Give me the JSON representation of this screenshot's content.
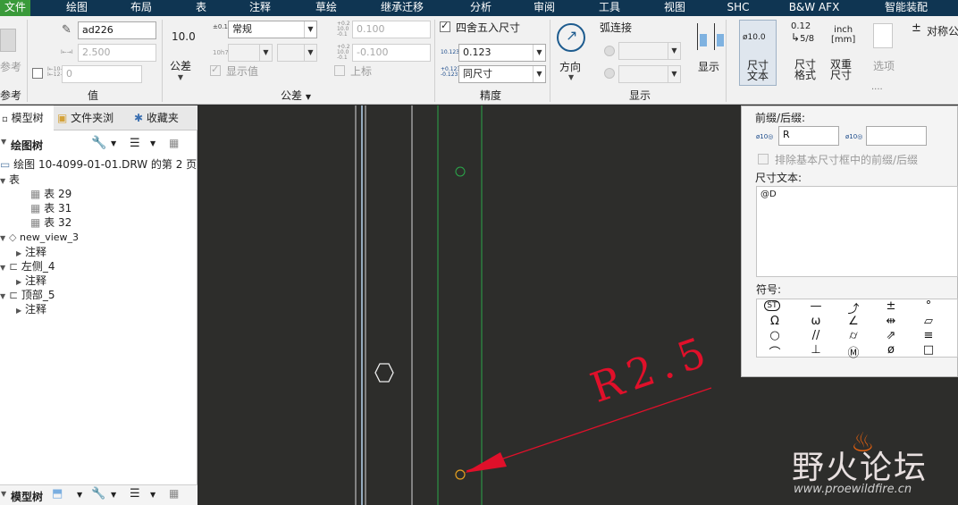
{
  "menubar": {
    "items": [
      "文件",
      "绘图",
      "布局",
      "表",
      "注释",
      "草绘",
      "继承迁移",
      "分析",
      "审阅",
      "工具",
      "视图",
      "SHC",
      "B&W AFX",
      "智能装配"
    ],
    "active": "文件"
  },
  "ribbon": {
    "ref_group": {
      "label": "参考",
      "group_label": "参考"
    },
    "value_group": {
      "name_value": "ad226",
      "value_placeholder": "2.500",
      "override_value": "0",
      "group_label": "值"
    },
    "tolerance_group": {
      "display_label": "10.0",
      "tol_button_label": "公差",
      "mode_value": "常规",
      "upper_value": "0.100",
      "lower_value": "-0.100",
      "show_value_label": "显示值",
      "upper_label": "上标",
      "group_label": "公差",
      "small_label_a": "±0.1",
      "small_label_b": "10h7"
    },
    "precision_group": {
      "round_label": "四舍五入尺寸",
      "precision_value": "0.123",
      "units_value": "同尺寸",
      "group_label": "精度",
      "icon_a": "10.123",
      "icon_b": "0.123"
    },
    "display_group": {
      "direction_label": "方向",
      "arc_label": "弧连接",
      "show_label": "显示",
      "group_label": "显示"
    },
    "text_group": {
      "dim_text_label": "尺寸文本",
      "dim_format_label": "尺寸格式",
      "dual_dim_label": "双重尺寸",
      "options_label": "选项",
      "symmetric_label": "对称公",
      "icon_small_text": "ø10.0",
      "unit_a": "0.12",
      "unit_b": "5/8",
      "unit_c": "inch",
      "unit_d": "[mm]",
      "overflow_dots": "····"
    }
  },
  "sidebar": {
    "tabs": [
      "模型树",
      "文件夹浏",
      "收藏夹"
    ],
    "header": "绘图树",
    "tree": [
      {
        "label": "绘图 10-4099-01-01.DRW 的第 2 页",
        "indent": 0
      },
      {
        "label": "表",
        "indent": 0
      },
      {
        "label": "表 29",
        "indent": 2
      },
      {
        "label": "表 31",
        "indent": 2
      },
      {
        "label": "表 32",
        "indent": 2
      },
      {
        "label": "new_view_3",
        "indent": 1
      },
      {
        "label": "注释",
        "indent": 2
      },
      {
        "label": "左侧_4",
        "indent": 1
      },
      {
        "label": "注释",
        "indent": 2
      },
      {
        "label": "顶部_5",
        "indent": 1
      },
      {
        "label": "注释",
        "indent": 2
      }
    ],
    "footer_tab": "模型树"
  },
  "panel": {
    "prefix_suffix_label": "前缀/后缀:",
    "prefix_value": "R",
    "suffix_value": "",
    "exclude_label": "排除基本尺寸框中的前缀/后缀",
    "dim_text_label": "尺寸文本:",
    "dim_text_value": "@D",
    "symbols_label": "符号:",
    "symbols": [
      "ST",
      "—",
      "⤴",
      "±",
      "°",
      "Ω",
      "ω",
      "∠",
      "⇹",
      "▱",
      "○",
      "//",
      "⌭",
      "⇗",
      "≡",
      "⌒",
      "⊥",
      "Ⓜ",
      "ø",
      "□"
    ]
  },
  "canvas": {
    "dimension_text": "R2.5",
    "dimension_color": "#e0102a"
  },
  "watermark": {
    "title": "野火论坛",
    "url": "www.proewildfire.cn"
  }
}
